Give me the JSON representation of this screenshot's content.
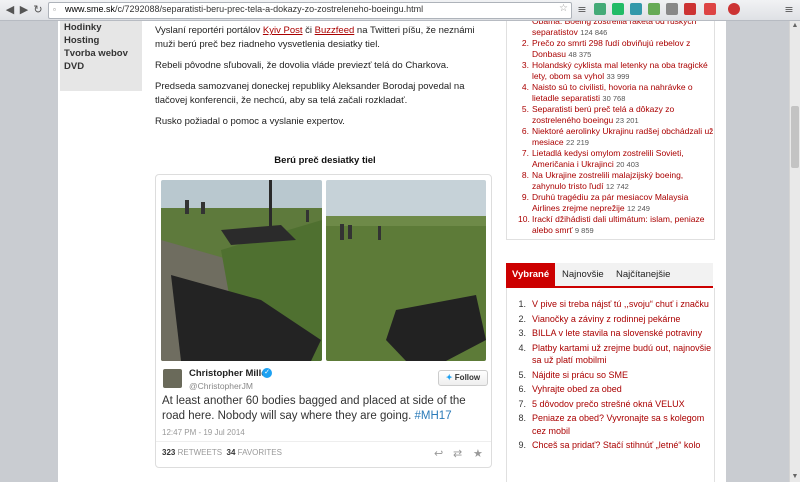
{
  "browser": {
    "url_host": "www.sme.sk",
    "url_path": "/c/7292088/separatisti-beru-prec-tela-a-dokazy-zo-zostreleneho-boeingu.html"
  },
  "left_menu": [
    "Hodinky",
    "Hosting",
    "Tvorba webov",
    "DVD"
  ],
  "article": {
    "p1_before": "Vyslaní reportéri portálov ",
    "p1_link1": "Kyiv Post",
    "p1_mid": " či ",
    "p1_link2": "Buzzfeed",
    "p1_after": " na Twitteri píšu, že neznámi muži berú preč bez riadneho vysvetlenia desiatky tiel.",
    "p2": "Rebeli pôvodne sľubovali, že dovolia vláde previezť telá do Charkova.",
    "p3": "Predseda samozvanej doneckej republiky Aleksander Borodaj povedal na tlačovej konferencii, že nechcú, aby sa telá začali rozkladať.",
    "p4": "Rusko požiadal o pomoc a vyslanie expertov.",
    "image_title": "Berú preč desiatky tiel"
  },
  "tweet": {
    "name": "Christopher Miller",
    "handle": "@ChristopherJM",
    "follow_label": "Follow",
    "text": "At least another 60 bodies bagged and placed at side of the road here. Nobody will say where they are going. ",
    "hashtag": "#MH17",
    "time": "12:47 PM - 19 Jul 2014",
    "retweets_count": "323",
    "retweets_label": "RETWEETS",
    "favorites_count": "34",
    "favorites_label": "FAVORITES"
  },
  "most_read": [
    {
      "n": "",
      "title": "Obama: Boeing zostrelila raketa od ruských separatistov",
      "count": "124 846"
    },
    {
      "n": "2.",
      "title": "Prečo zo smrti 298 ľudí obviňujú rebelov z Donbasu",
      "count": "48 375"
    },
    {
      "n": "3.",
      "title": "Holandský cyklista mal letenky na oba tragické lety, obom sa vyhol",
      "count": "33 999"
    },
    {
      "n": "4.",
      "title": "Naisto sú to civilisti, hovoria na nahrávke o lietadle separatisti",
      "count": "30 768"
    },
    {
      "n": "5.",
      "title": "Separatisti berú preč telá a dôkazy zo zostreleného boeingu",
      "count": "23 201"
    },
    {
      "n": "6.",
      "title": "Niektoré aerolinky Ukrajinu radšej obchádzali už mesiace",
      "count": "22 219"
    },
    {
      "n": "7.",
      "title": "Lietadlá kedysi omylom zostrelili Sovieti, Američania i Ukrajinci",
      "count": "20 403"
    },
    {
      "n": "8.",
      "title": "Na Ukrajine zostrelili malajzijský boeing, zahynulo tristo ľudí",
      "count": "12 742"
    },
    {
      "n": "9.",
      "title": "Druhú tragédiu za pár mesiacov Malaysia Airlines zrejme neprežije",
      "count": "12 249"
    },
    {
      "n": "10.",
      "title": "Irackí džihádisti dali ultimátum: islam, peniaze alebo smrť",
      "count": "9 859"
    }
  ],
  "tabs": [
    "Vybrané",
    "Najnovšie",
    "Najčítanejšie"
  ],
  "selected": [
    {
      "n": "1.",
      "title": "V pive si treba nájsť tú ,,svoju“ chuť i značku"
    },
    {
      "n": "2.",
      "title": "Vianočky a záviny z rodinnej pekárne"
    },
    {
      "n": "3.",
      "title": "BILLA v lete stavila na slovenské potraviny"
    },
    {
      "n": "4.",
      "title": "Platby kartami už zrejme budú out, najnovšie sa už platí mobilmi"
    },
    {
      "n": "5.",
      "title": "Nájdite si prácu so SME"
    },
    {
      "n": "6.",
      "title": "Vyhrajte obed za obed"
    },
    {
      "n": "7.",
      "title": "5 dôvodov prečo strešné okná VELUX"
    },
    {
      "n": "8.",
      "title": "Peniaze za obed? Vyvronajte sa s kolegom cez mobil"
    },
    {
      "n": "9.",
      "title": "Chceš sa pridať? Stačí stihnúť „letné“ kolo"
    }
  ]
}
